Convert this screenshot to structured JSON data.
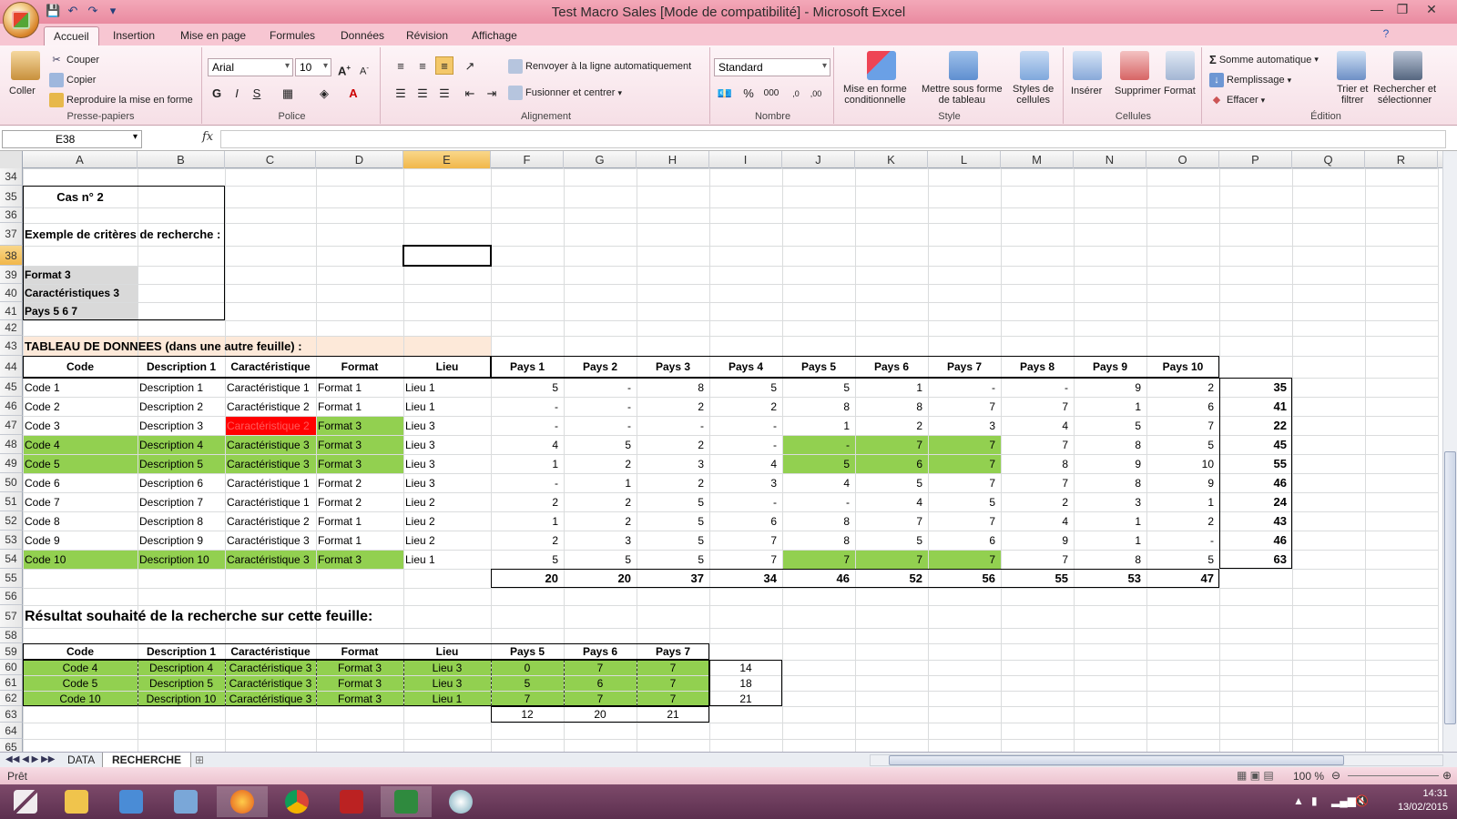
{
  "window": {
    "title": "Test Macro Sales  [Mode de compatibilité] - Microsoft Excel"
  },
  "ribbon": {
    "tabs": [
      "Accueil",
      "Insertion",
      "Mise en page",
      "Formules",
      "Données",
      "Révision",
      "Affichage"
    ],
    "clipboard": {
      "label": "Presse-papiers",
      "paste": "Coller",
      "cut": "Couper",
      "copy": "Copier",
      "format_painter": "Reproduire la mise en forme"
    },
    "font": {
      "label": "Police",
      "name": "Arial",
      "size": "10",
      "bold": "G",
      "italic": "I",
      "underline": "S"
    },
    "alignment": {
      "label": "Alignement",
      "wrap": "Renvoyer à la ligne automatiquement",
      "merge": "Fusionner et centrer"
    },
    "number": {
      "label": "Nombre",
      "format": "Standard",
      "percent": "%",
      "thousands": "000"
    },
    "style": {
      "label": "Style",
      "cond_format_1": "Mise en forme",
      "cond_format_2": "conditionnelle",
      "table_format_1": "Mettre sous forme",
      "table_format_2": "de tableau",
      "cell_styles_1": "Styles de",
      "cell_styles_2": "cellules"
    },
    "cells": {
      "label": "Cellules",
      "insert": "Insérer",
      "delete": "Supprimer",
      "format": "Format"
    },
    "editing": {
      "label": "Édition",
      "autosum": "Somme automatique",
      "fill": "Remplissage",
      "clear": "Effacer",
      "sort_1": "Trier et",
      "sort_2": "filtrer",
      "find_1": "Rechercher et",
      "find_2": "sélectionner"
    }
  },
  "formula_bar": {
    "name_box": "E38",
    "fx": "fx",
    "value": ""
  },
  "columns": [
    "A",
    "B",
    "C",
    "D",
    "E",
    "F",
    "G",
    "H",
    "I",
    "J",
    "K",
    "L",
    "M",
    "N",
    "O",
    "P",
    "Q",
    "R"
  ],
  "rows": [
    "34",
    "35",
    "36",
    "37",
    "38",
    "39",
    "40",
    "41",
    "42",
    "43",
    "44",
    "45",
    "46",
    "47",
    "48",
    "49",
    "50",
    "51",
    "52",
    "53",
    "54",
    "55",
    "56",
    "57",
    "58",
    "59",
    "60",
    "61",
    "62",
    "63",
    "64",
    "65"
  ],
  "criteria": {
    "title": "Cas n° 2",
    "subtitle": "Exemple de critères de recherche :",
    "items": [
      "Format 3",
      "Caractéristiques 3",
      "Pays 5 6 7"
    ]
  },
  "data_table": {
    "title": "TABLEAU DE DONNEES (dans une autre feuille) :",
    "headers": [
      "Code",
      "Description 1",
      "Caractéristique",
      "Format",
      "Lieu",
      "Pays 1",
      "Pays 2",
      "Pays 3",
      "Pays 4",
      "Pays 5",
      "Pays 6",
      "Pays 7",
      "Pays 8",
      "Pays 9",
      "Pays 10"
    ],
    "rows": [
      [
        "Code 1",
        "Description 1",
        "Caractéristique 1",
        "Format 1",
        "Lieu 1",
        "5",
        "-",
        "8",
        "5",
        "5",
        "1",
        "-",
        "-",
        "9",
        "2",
        "35"
      ],
      [
        "Code 2",
        "Description 2",
        "Caractéristique 2",
        "Format 1",
        "Lieu 1",
        "-",
        "-",
        "2",
        "2",
        "8",
        "8",
        "7",
        "7",
        "1",
        "6",
        "41"
      ],
      [
        "Code 3",
        "Description 3",
        "Caractéristique 2",
        "Format 3",
        "Lieu 3",
        "-",
        "-",
        "-",
        "-",
        "1",
        "2",
        "3",
        "4",
        "5",
        "7",
        "22"
      ],
      [
        "Code 4",
        "Description 4",
        "Caractéristique 3",
        "Format 3",
        "Lieu 3",
        "4",
        "5",
        "2",
        "-",
        "-",
        "7",
        "7",
        "7",
        "8",
        "5",
        "45"
      ],
      [
        "Code 5",
        "Description 5",
        "Caractéristique 3",
        "Format 3",
        "Lieu 3",
        "1",
        "2",
        "3",
        "4",
        "5",
        "6",
        "7",
        "8",
        "9",
        "10",
        "55"
      ],
      [
        "Code 6",
        "Description 6",
        "Caractéristique 1",
        "Format 2",
        "Lieu 3",
        "-",
        "1",
        "2",
        "3",
        "4",
        "5",
        "7",
        "7",
        "8",
        "9",
        "46"
      ],
      [
        "Code 7",
        "Description 7",
        "Caractéristique 1",
        "Format 2",
        "Lieu 2",
        "2",
        "2",
        "5",
        "-",
        "-",
        "4",
        "5",
        "2",
        "3",
        "1",
        "24"
      ],
      [
        "Code 8",
        "Description 8",
        "Caractéristique 2",
        "Format 1",
        "Lieu 2",
        "1",
        "2",
        "5",
        "6",
        "8",
        "7",
        "7",
        "4",
        "1",
        "2",
        "43"
      ],
      [
        "Code 9",
        "Description 9",
        "Caractéristique 3",
        "Format 1",
        "Lieu 2",
        "2",
        "3",
        "5",
        "7",
        "8",
        "5",
        "6",
        "9",
        "1",
        "-",
        "46"
      ],
      [
        "Code 10",
        "Description 10",
        "Caractéristique 3",
        "Format 3",
        "Lieu 1",
        "5",
        "5",
        "5",
        "7",
        "7",
        "7",
        "7",
        "7",
        "8",
        "5",
        "63"
      ]
    ],
    "totals": [
      "20",
      "20",
      "37",
      "34",
      "46",
      "52",
      "56",
      "55",
      "53",
      "47"
    ]
  },
  "result": {
    "title": "Résultat souhaité de la recherche sur cette feuille:",
    "headers": [
      "Code",
      "Description 1",
      "Caractéristique",
      "Format",
      "Lieu",
      "Pays 5",
      "Pays 6",
      "Pays 7"
    ],
    "rows": [
      [
        "Code 4",
        "Description 4",
        "Caractéristique 3",
        "Format 3",
        "Lieu 3",
        "0",
        "7",
        "7",
        "14"
      ],
      [
        "Code 5",
        "Description 5",
        "Caractéristique 3",
        "Format 3",
        "Lieu 3",
        "5",
        "6",
        "7",
        "18"
      ],
      [
        "Code 10",
        "Description 10",
        "Caractéristique 3",
        "Format 3",
        "Lieu 1",
        "7",
        "7",
        "7",
        "21"
      ]
    ],
    "totals": [
      "12",
      "20",
      "21"
    ]
  },
  "sheets": [
    "DATA",
    "RECHERCHE"
  ],
  "status": {
    "ready": "Prêt",
    "zoom": "100 %"
  },
  "taskbar": {
    "time": "14:31",
    "date": "13/02/2015"
  },
  "colors": {
    "green": "#92d050",
    "red": "#ff0000",
    "grey": "#d9d9d9",
    "peach": "#fde9d9",
    "accent": "#e98aa0"
  }
}
